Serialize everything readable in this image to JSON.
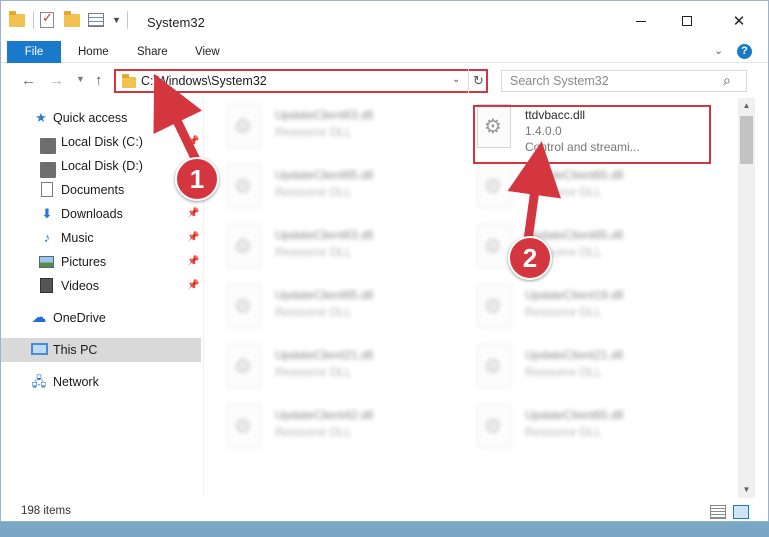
{
  "window": {
    "title": "System32"
  },
  "ribbon": {
    "tabs": [
      "File",
      "Home",
      "Share",
      "View"
    ]
  },
  "navbar": {
    "address": "C:\\Windows\\System32",
    "search_placeholder": "Search System32"
  },
  "sidebar": {
    "items": [
      {
        "label": "Quick access",
        "icon": "star-icon",
        "pinned": false
      },
      {
        "label": "Local Disk (C:)",
        "icon": "drive-icon",
        "pinned": true
      },
      {
        "label": "Local Disk (D:)",
        "icon": "drive-icon",
        "pinned": false
      },
      {
        "label": "Documents",
        "icon": "document-icon",
        "pinned": true
      },
      {
        "label": "Downloads",
        "icon": "download-icon",
        "pinned": true
      },
      {
        "label": "Music",
        "icon": "music-icon",
        "pinned": true
      },
      {
        "label": "Pictures",
        "icon": "picture-icon",
        "pinned": true
      },
      {
        "label": "Videos",
        "icon": "video-icon",
        "pinned": true
      },
      {
        "label": "OneDrive",
        "icon": "onedrive-icon",
        "pinned": false
      },
      {
        "label": "This PC",
        "icon": "pc-icon",
        "pinned": false,
        "selected": true
      },
      {
        "label": "Network",
        "icon": "network-icon",
        "pinned": false
      }
    ]
  },
  "files": {
    "left": [
      {
        "name": "UpdateClient63.dll",
        "desc": "Resource DLL"
      },
      {
        "name": "UpdateClient65.dll",
        "desc": "Resource DLL"
      },
      {
        "name": "UpdateClient63.dll",
        "desc": "Resource DLL"
      },
      {
        "name": "UpdateClient65.dll",
        "desc": "Resource DLL"
      },
      {
        "name": "UpdateClient21.dll",
        "desc": "Resource DLL"
      },
      {
        "name": "UpdateClient42.dll",
        "desc": "Resource DLL"
      }
    ],
    "right": [
      {
        "name": "ttdvbacc.dll",
        "version": "1.4.0.0",
        "desc": "Control and streami..."
      },
      {
        "name": "UpdateClient65.dll",
        "desc": "Resource DLL"
      },
      {
        "name": "UpdateClient65.dll",
        "desc": "Resource DLL"
      },
      {
        "name": "UpdateClient19.dll",
        "desc": "Resource DLL"
      },
      {
        "name": "UpdateClient21.dll",
        "desc": "Resource DLL"
      },
      {
        "name": "UpdateClient65.dll",
        "desc": "Resource DLL"
      }
    ]
  },
  "statusbar": {
    "item_count": "198 items"
  },
  "annotations": {
    "step1": "1",
    "step2": "2",
    "color": "#d4363f"
  }
}
